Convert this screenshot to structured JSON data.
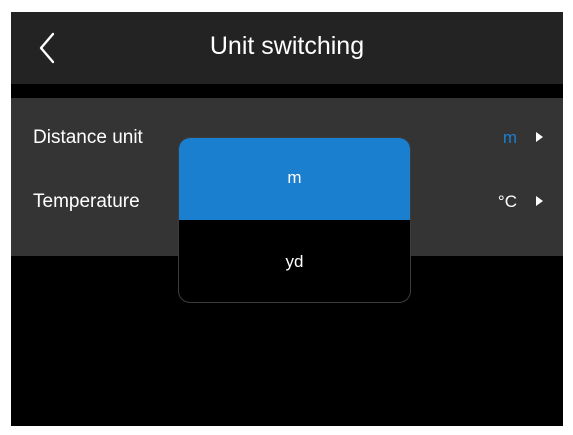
{
  "header": {
    "title": "Unit switching",
    "back_icon": "chevron-left-icon"
  },
  "settings": {
    "rows": [
      {
        "label": "Distance unit",
        "value": "m",
        "value_color": "#1b7fd0"
      },
      {
        "label": "Temperature",
        "value": "°C",
        "value_color": "#ffffff"
      }
    ],
    "arrow_icon": "caret-right-icon"
  },
  "dropdown": {
    "options": [
      {
        "label": "m",
        "selected": true
      },
      {
        "label": "yd",
        "selected": false
      }
    ],
    "selected_color": "#1b7fd0"
  },
  "colors": {
    "header_bg": "#232323",
    "list_bg": "#343434",
    "screen_bg": "#000000",
    "accent": "#1b7fd0"
  }
}
